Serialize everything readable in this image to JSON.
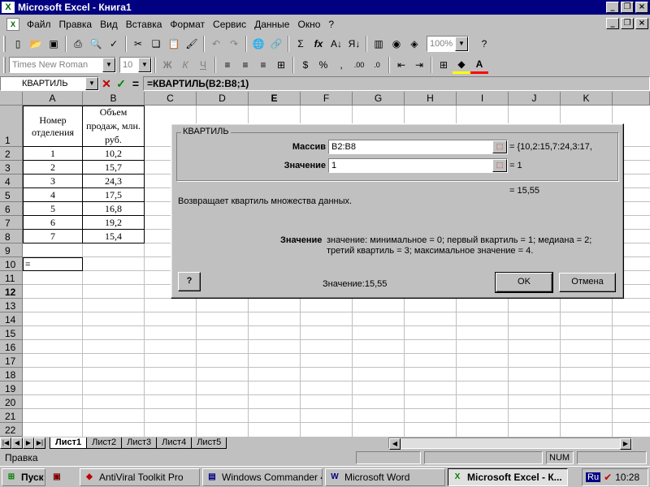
{
  "window": {
    "title": "Microsoft Excel - Книга1"
  },
  "menu": [
    "Файл",
    "Правка",
    "Вид",
    "Вставка",
    "Формат",
    "Сервис",
    "Данные",
    "Окно",
    "?"
  ],
  "toolbar": {
    "zoom": "100%",
    "font_name": "Times New Roman",
    "font_size": "10"
  },
  "formula_bar": {
    "name_box": "КВАРТИЛЬ",
    "formula": "=КВАРТИЛЬ(B2:B8;1)"
  },
  "columns": [
    "A",
    "B",
    "C",
    "D",
    "E",
    "F",
    "G",
    "H",
    "I",
    "J",
    "K"
  ],
  "rows": [
    "1",
    "2",
    "3",
    "4",
    "5",
    "6",
    "7",
    "8",
    "9",
    "10",
    "11",
    "12",
    "13",
    "14",
    "15",
    "16",
    "17",
    "18",
    "19",
    "20",
    "21",
    "22"
  ],
  "table": {
    "header_a": "Номер отделения",
    "header_b": "Объем продаж, млн. руб.",
    "data": [
      [
        "1",
        "10,2"
      ],
      [
        "2",
        "15,7"
      ],
      [
        "3",
        "24,3"
      ],
      [
        "4",
        "17,5"
      ],
      [
        "5",
        "16,8"
      ],
      [
        "6",
        "19,2"
      ],
      [
        "7",
        "15,4"
      ]
    ],
    "a10": "="
  },
  "dialog": {
    "group_title": "КВАРТИЛЬ",
    "array_label": "Массив",
    "array_value": "B2:B8",
    "array_result": "= {10,2:15,7:24,3:17,",
    "quart_label": "Значение",
    "quart_value": "1",
    "quart_result": "= 1",
    "formula_result": "= 15,55",
    "description": "Возвращает квартиль множества данных.",
    "arg_name": "Значение",
    "arg_help_1": "значение: минимальное = 0; первый вкартиль = 1; медиана = 2;",
    "arg_help_2": "третий квартиль = 3; максимальное значение = 4.",
    "value_text": "Значение:15,55",
    "ok": "OK",
    "cancel": "Отмена"
  },
  "sheet_tabs": [
    "Лист1",
    "Лист2",
    "Лист3",
    "Лист4",
    "Лист5"
  ],
  "status": {
    "mode": "Правка",
    "num": "NUM"
  },
  "taskbar": {
    "start": "Пуск",
    "items": [
      "AntiViral Toolkit Pro",
      "Windows Commander 4...",
      "Microsoft Word",
      "Microsoft Excel - К..."
    ],
    "lang": "Ru",
    "clock": "10:28"
  }
}
